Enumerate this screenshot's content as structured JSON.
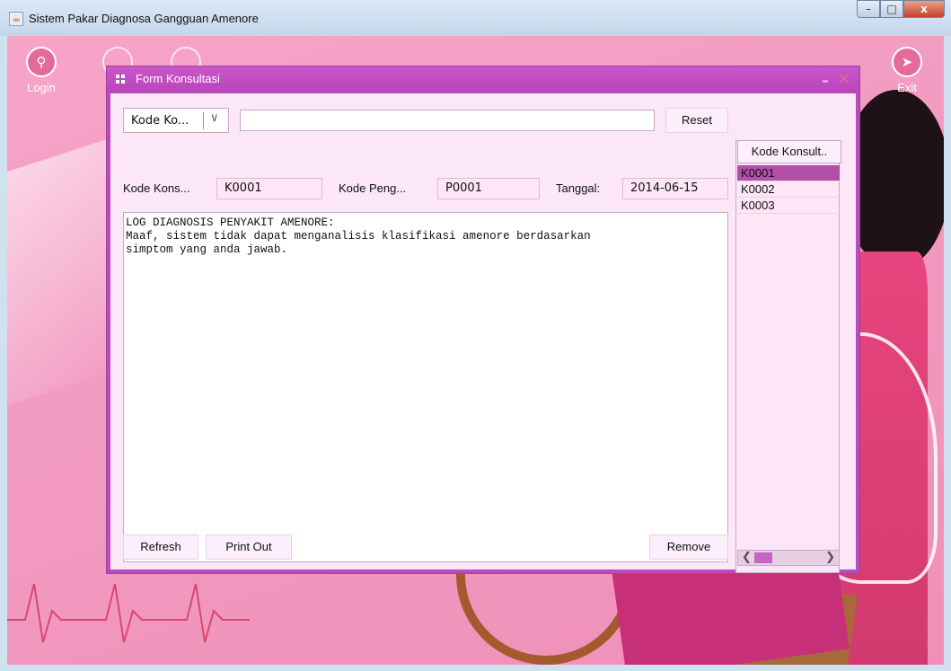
{
  "window": {
    "title": "Sistem Pakar Diagnosa Gangguan Amenore",
    "controls": {
      "minimize": "–",
      "maximize": "□",
      "close": "x"
    }
  },
  "sidebar": {
    "login_label": "Login",
    "exit_label": "Exit"
  },
  "form": {
    "title": "Form Konsultasi",
    "minimize": "–",
    "close": "✕",
    "search": {
      "combo_value": "Kode Ko...",
      "input_value": "",
      "reset_label": "Reset"
    },
    "fields": {
      "kode_konsultasi_label": "Kode Kons...",
      "kode_konsultasi_value": "K0001",
      "kode_pengguna_label": "Kode Peng...",
      "kode_pengguna_value": "P0001",
      "tanggal_label": "Tanggal:",
      "tanggal_value": "2014-06-15"
    },
    "log_text": "LOG DIAGNOSIS PENYAKIT AMENORE:\nMaaf, sistem tidak dapat menganalisis klasifikasi amenore berdasarkan\nsimptom yang anda jawab.",
    "buttons": {
      "refresh": "Refresh",
      "print_out": "Print Out",
      "remove": "Remove"
    },
    "list": {
      "header": "Kode Konsult..",
      "items": [
        "K0001",
        "K0002",
        "K0003"
      ],
      "selected": "K0001"
    }
  },
  "colors": {
    "accent": "#b945bb",
    "background_pink": "#f39ac0",
    "selected_row": "#b14fa9"
  }
}
